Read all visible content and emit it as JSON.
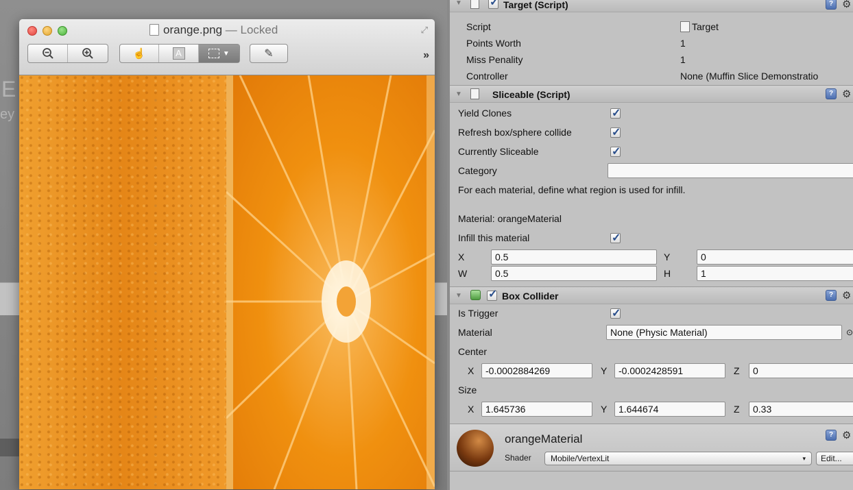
{
  "preview_window": {
    "title": "orange.png",
    "locked_label": "— Locked",
    "toolbar": {
      "zoom_out_icon": "zoom-out-icon",
      "zoom_in_icon": "zoom-in-icon",
      "hand_icon": "hand-icon",
      "text_select_label": "A",
      "rect_select_icon": "rect-select-icon",
      "edit_icon": "pencil-icon",
      "overflow_label": "»"
    }
  },
  "inspector": {
    "target_script": {
      "title": "Target (Script)",
      "fields": [
        {
          "label": "Script",
          "value": "Target"
        },
        {
          "label": "Points Worth",
          "value": "1"
        },
        {
          "label": "Miss Penality",
          "value": "1"
        },
        {
          "label": "Controller",
          "value": "None (Muffin Slice Demonstratio"
        }
      ]
    },
    "sliceable_script": {
      "title": "Sliceable (Script)",
      "yield_clones": "Yield Clones",
      "refresh_collider": "Refresh box/sphere collide",
      "currently_sliceable": "Currently Sliceable",
      "category": "Category",
      "category_value": "",
      "infill_note": "For each material, define what region is used for infill.",
      "material_label": "Material: orangeMaterial",
      "infill_this": "Infill this material",
      "x_label": "X",
      "x_value": "0.5",
      "y_label": "Y",
      "y_value": "0",
      "w_label": "W",
      "w_value": "0.5",
      "h_label": "H",
      "h_value": "1"
    },
    "box_collider": {
      "title": "Box Collider",
      "is_trigger": "Is Trigger",
      "material_label": "Material",
      "material_value": "None (Physic Material)",
      "center_label": "Center",
      "center": {
        "x_label": "X",
        "x": "-0.0002884269",
        "y_label": "Y",
        "y": "-0.0002428591",
        "z_label": "Z",
        "z": "0"
      },
      "size_label": "Size",
      "size": {
        "x_label": "X",
        "x": "1.645736",
        "y_label": "Y",
        "y": "1.644674",
        "z_label": "Z",
        "z": "0.33"
      }
    },
    "material": {
      "name": "orangeMaterial",
      "shader_label": "Shader",
      "shader_value": "Mobile/VertexLit",
      "edit_button": "Edit..."
    }
  }
}
